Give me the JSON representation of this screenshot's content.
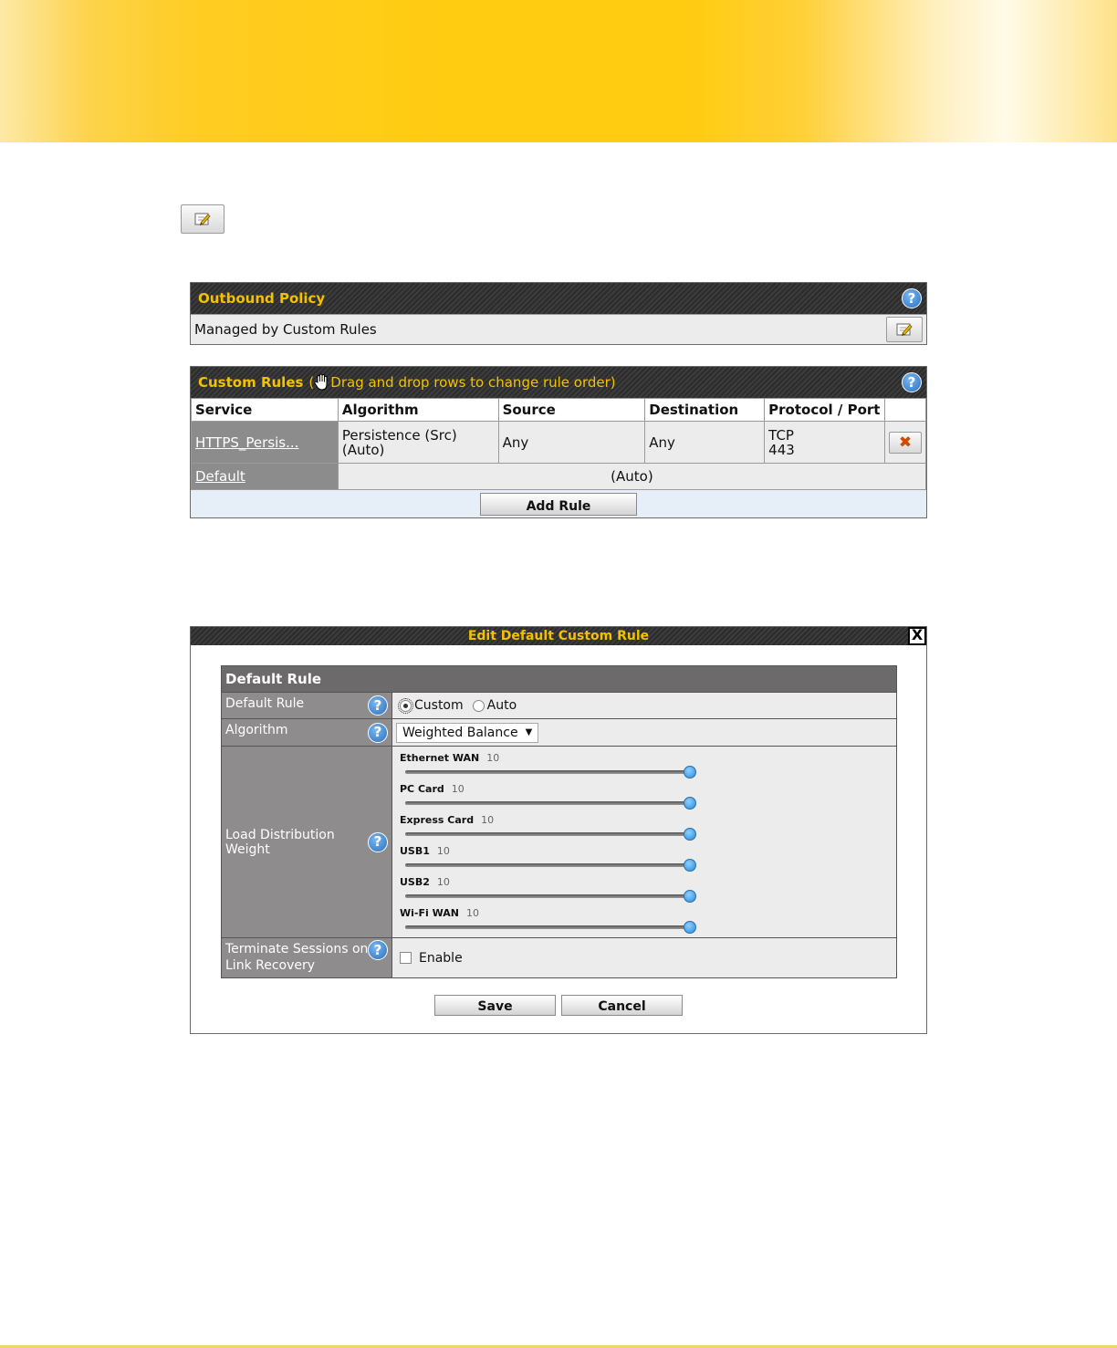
{
  "outbound": {
    "title": "Outbound Policy",
    "summary": "Managed by Custom Rules"
  },
  "custom_rules": {
    "title": "Custom Rules",
    "hint_open": "(",
    "hint": "Drag and drop rows to change rule order)",
    "columns": [
      "Service",
      "Algorithm",
      "Source",
      "Destination",
      "Protocol / Port"
    ],
    "rows": [
      {
        "service": "HTTPS_Persis...",
        "algorithm_1": "Persistence (Src)",
        "algorithm_2": "(Auto)",
        "source": "Any",
        "destination": "Any",
        "protocol": "TCP",
        "port": "443"
      }
    ],
    "default_row": {
      "service": "Default",
      "value": "(Auto)"
    },
    "add_label": "Add Rule"
  },
  "dialog": {
    "title": "Edit Default Custom Rule",
    "close_label": "X",
    "section_title": "Default Rule",
    "default_rule": {
      "label": "Default Rule",
      "option_custom": "Custom",
      "option_auto": "Auto",
      "selected": "Custom"
    },
    "algorithm": {
      "label": "Algorithm",
      "selected": "Weighted Balance"
    },
    "load_distribution": {
      "label": "Load Distribution Weight",
      "max": 10,
      "items": [
        {
          "name": "Ethernet WAN",
          "value": "10"
        },
        {
          "name": "PC Card",
          "value": "10"
        },
        {
          "name": "Express Card",
          "value": "10"
        },
        {
          "name": "USB1",
          "value": "10"
        },
        {
          "name": "USB2",
          "value": "10"
        },
        {
          "name": "Wi-Fi WAN",
          "value": "10"
        }
      ]
    },
    "terminate": {
      "label": "Terminate Sessions on Link Recovery",
      "option": "Enable"
    },
    "save_label": "Save",
    "cancel_label": "Cancel"
  },
  "help_glyph": "?",
  "delete_glyph": "✖",
  "icons": {
    "edit": "edit-icon",
    "help": "help-icon",
    "delete": "delete-icon",
    "hand": "hand-icon"
  },
  "colors": {
    "title_text": "#f2c200",
    "banner": "#ffcc11"
  }
}
